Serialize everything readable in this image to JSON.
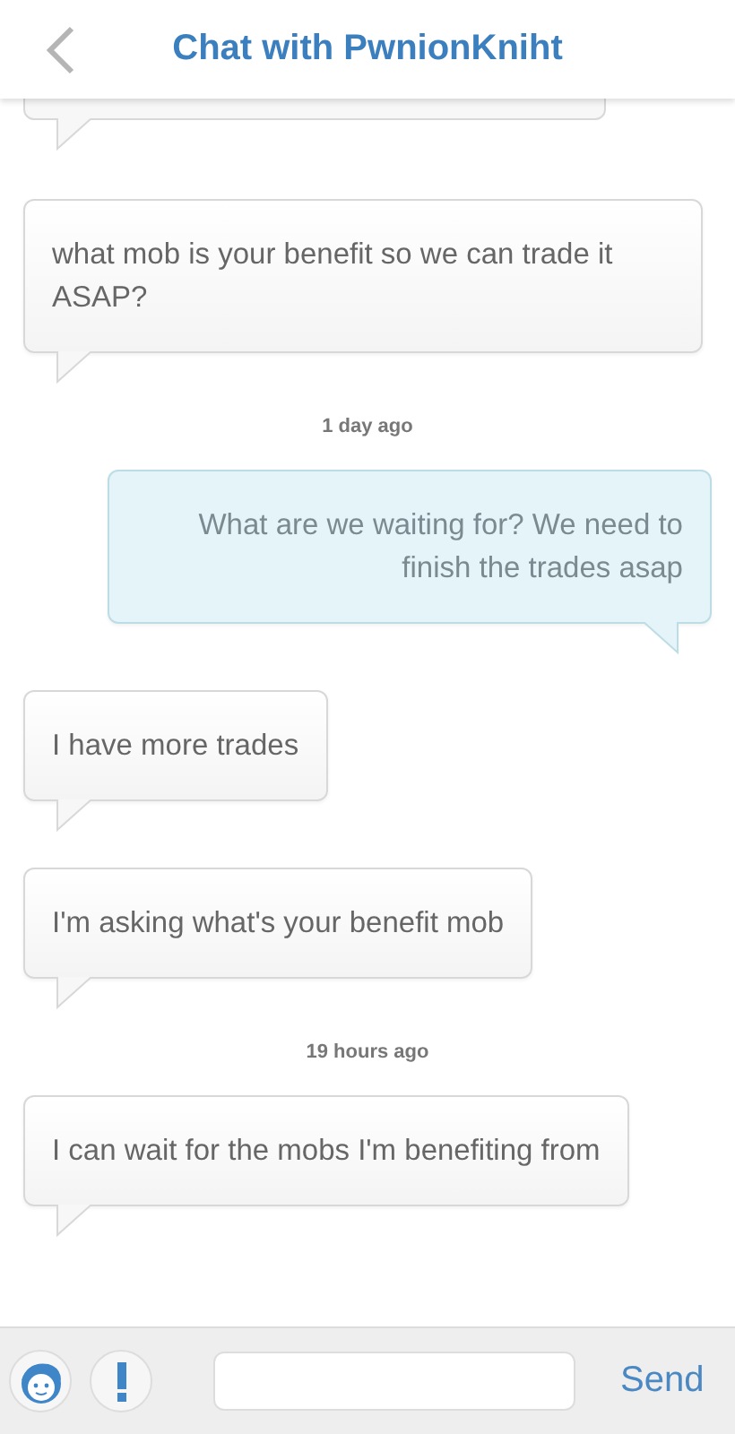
{
  "header": {
    "title": "Chat with PwnionKniht"
  },
  "messages": [
    {
      "kind": "received",
      "text": "what mob is your benefit so we can trade it ASAP?"
    },
    {
      "kind": "time",
      "text": "1 day ago"
    },
    {
      "kind": "sent",
      "text": "What are we waiting for? We need to finish the trades asap"
    },
    {
      "kind": "received",
      "text": "I have more trades"
    },
    {
      "kind": "received",
      "text": "I'm asking what's your benefit mob"
    },
    {
      "kind": "time",
      "text": "19 hours ago"
    },
    {
      "kind": "received",
      "text": "I can wait for the mobs I'm benefiting from"
    }
  ],
  "composer": {
    "send": "Send"
  }
}
